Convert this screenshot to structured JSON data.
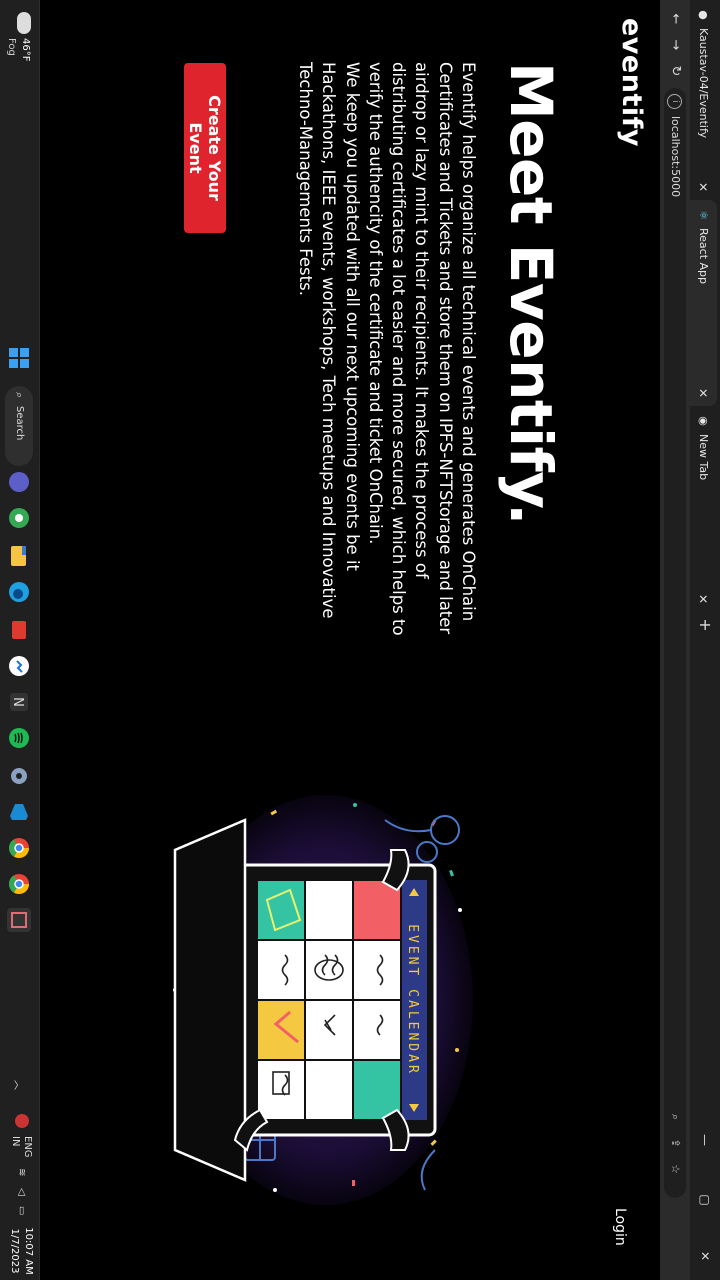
{
  "browser": {
    "tabs": [
      {
        "title": "Kaustav-04/Eventify",
        "icon": "github-icon",
        "active": false
      },
      {
        "title": "React App",
        "icon": "react-icon",
        "active": true
      },
      {
        "title": "New Tab",
        "icon": "chrome-icon",
        "active": false
      }
    ],
    "new_tab_label": "+",
    "close_label": "✕",
    "url": "localhost:5000",
    "window_controls": {
      "minimize": "—",
      "maximize": "▢",
      "close": "✕"
    }
  },
  "page": {
    "brand": "eventify",
    "login_label": "Login",
    "title": "Meet Eventify.",
    "description_lines": [
      "Eventify helps organize all technical events and generates OnChain",
      "Certificates and Tickets and store them on IPFS-NFTStorage and later",
      "airdrop or lazy mint to their recipients. It makes the process of",
      "distributing certificates a lot easier and more secured, which helps to",
      "verify the authencity of the certificate and ticket OnChain.",
      "We keep you updated with all our next upcoming events be it",
      "Hackathons, IEEE events, workshops, Tech meetups and Innovative",
      "Techno-Managements Fests."
    ],
    "cta_label": "Create Your Event",
    "illustration_caption": "EVENT CALENDAR"
  },
  "taskbar": {
    "weather_temp": "46°F",
    "weather_cond": "Fog",
    "search_label": "Search",
    "lang_top": "ENG",
    "lang_bottom": "IN",
    "time": "10:07 AM",
    "date": "1/7/2023"
  },
  "colors": {
    "accent": "#e0242d",
    "background": "#000000",
    "calendar_red": "#f26065",
    "calendar_teal": "#34c3a3",
    "calendar_yellow": "#f5c842",
    "calendar_header": "#2c3a87"
  }
}
